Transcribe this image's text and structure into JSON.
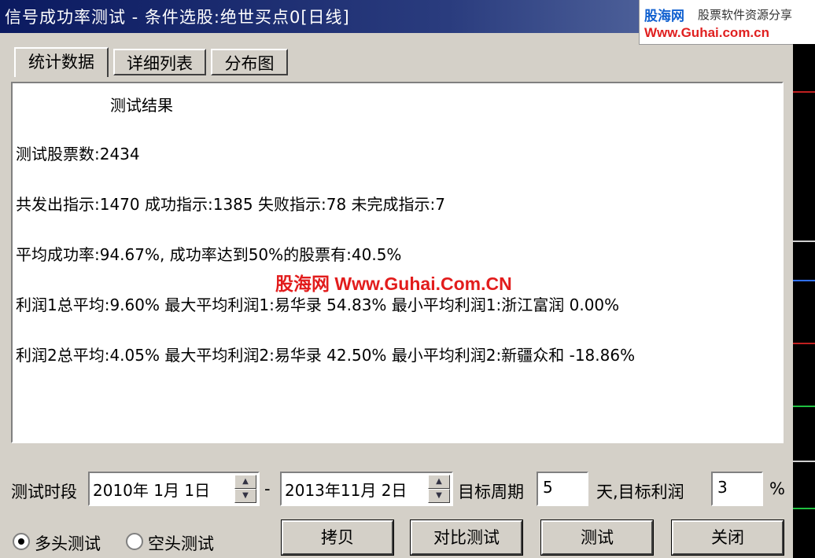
{
  "window": {
    "title": "信号成功率测试 - 条件选股:绝世买点0[日线]"
  },
  "logo": {
    "brand": "股海网",
    "slogan": "股票软件资源分享",
    "url": "Www.Guhai.com.cn"
  },
  "tabs": [
    {
      "label": "统计数据",
      "active": true
    },
    {
      "label": "详细列表",
      "active": false
    },
    {
      "label": "分布图",
      "active": false
    }
  ],
  "results": {
    "heading": "测试结果",
    "lines": [
      "测试股票数:2434",
      "共发出指示:1470 成功指示:1385 失败指示:78 未完成指示:7",
      "平均成功率:94.67%, 成功率达到50%的股票有:40.5%",
      "利润1总平均:9.60% 最大平均利润1:易华录    54.83% 最小平均利润1:浙江富润 0.00%",
      "利润2总平均:4.05% 最大平均利润2:易华录    42.50% 最小平均利润2:新疆众和 -18.86%"
    ]
  },
  "watermark": "股海网 Www.Guhai.Com.CN",
  "controls": {
    "period_label": "测试时段",
    "start_date": "2010年 1月 1日",
    "dash": "-",
    "end_date": "2013年11月 2日",
    "target_period_label": "目标周期",
    "target_period_value": "5",
    "days_profit_label": "天,目标利润",
    "target_profit_value": "3",
    "percent_sign": "%"
  },
  "radios": [
    {
      "label": "多头测试",
      "checked": true
    },
    {
      "label": "空头测试",
      "checked": false
    }
  ],
  "buttons": {
    "copy": "拷贝",
    "compare": "对比测试",
    "test": "测试",
    "close": "关闭"
  }
}
